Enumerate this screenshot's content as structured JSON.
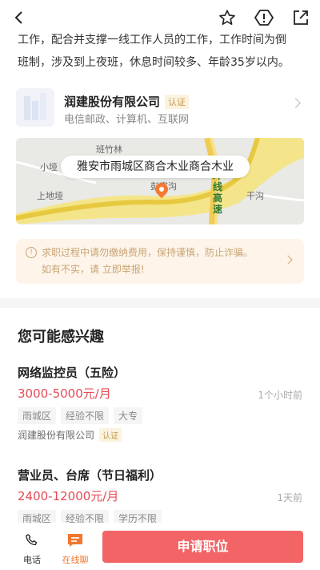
{
  "description": {
    "line1": "工作，配合并支撑一线工作人员的工作，工作时间为倒",
    "line2": "班制，涉及到上夜班，休息时间较多、年龄35岁以内。"
  },
  "company": {
    "name": "润建股份有限公司",
    "cert": "认证",
    "tags": "电信邮政、计算机、互联网"
  },
  "map": {
    "address": "雅安市雨城区商合木业商合木业",
    "labels": [
      "班竹林",
      "小垭",
      "上地垭",
      "彭家沟",
      "干沟",
      "环线高速"
    ]
  },
  "warning": {
    "line1": "求职过程中请勿缴纳费用，保持谨慎，防止诈骗。",
    "line2": "如有不实，请 立即举报!"
  },
  "section_title": "您可能感兴趣",
  "jobs": [
    {
      "title": "网络监控员（五险）",
      "salary": "3000-5000元/月",
      "time": "1个小时前",
      "tags": [
        "雨城区",
        "经验不限",
        "大专"
      ],
      "company": "润建股份有限公司",
      "cert": "认证"
    },
    {
      "title": "营业员、台席（节日福利）",
      "salary": "2400-12000元/月",
      "time": "1天前",
      "tags": [
        "雨城区",
        "经验不限",
        "学历不限"
      ]
    }
  ],
  "bottom": {
    "phone_label": "电话",
    "chat_label": "在线聊",
    "apply_label": "申请职位"
  },
  "colors": {
    "accent": "#f36467",
    "salary": "#e64b57",
    "chat": "#f2772f"
  }
}
